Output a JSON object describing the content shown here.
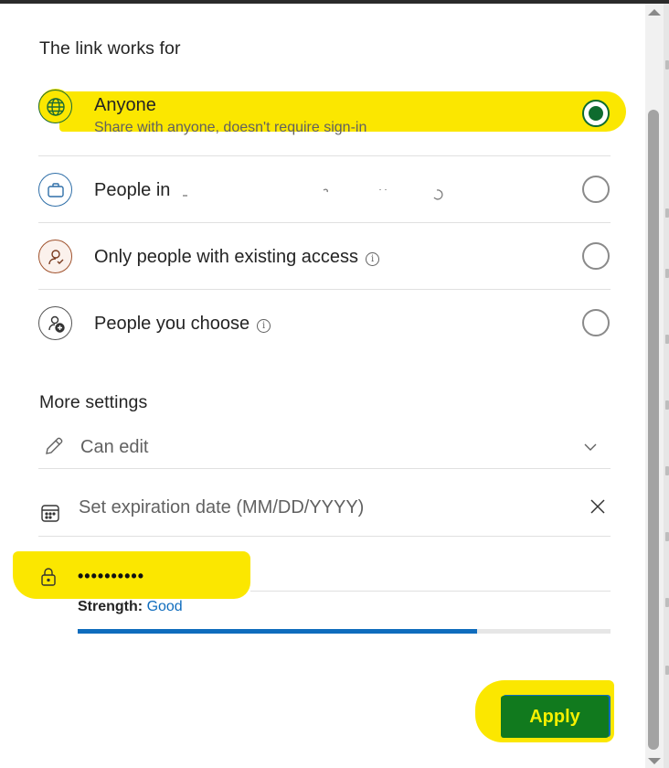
{
  "link_section": {
    "heading": "The link works for",
    "options": [
      {
        "title": "Anyone",
        "subtitle": "Share with anyone, doesn't require sign-in",
        "icon": "globe-icon",
        "selected": true
      },
      {
        "title": "People in",
        "subtitle": "",
        "icon": "briefcase-icon",
        "selected": false
      },
      {
        "title": "Only people with existing access",
        "subtitle": "",
        "icon": "person-check-icon",
        "selected": false,
        "info": "i"
      },
      {
        "title": "People you choose",
        "subtitle": "",
        "icon": "person-add-icon",
        "selected": false,
        "info": "i"
      }
    ]
  },
  "more_settings": {
    "heading": "More settings",
    "permission": {
      "value": "Can edit"
    },
    "expiration": {
      "placeholder": "Set expiration date (MM/DD/YYYY)"
    },
    "password": {
      "value": "••••••••••"
    },
    "strength": {
      "label": "Strength:",
      "value": "Good",
      "fraction": 0.75
    }
  },
  "apply_label": "Apply",
  "colors": {
    "highlight": "#fbe700",
    "selected_radio": "#0e6b2e",
    "apply_bg": "#117a1e",
    "apply_text": "#f5f000",
    "strength_bar": "#0f6cbd"
  }
}
